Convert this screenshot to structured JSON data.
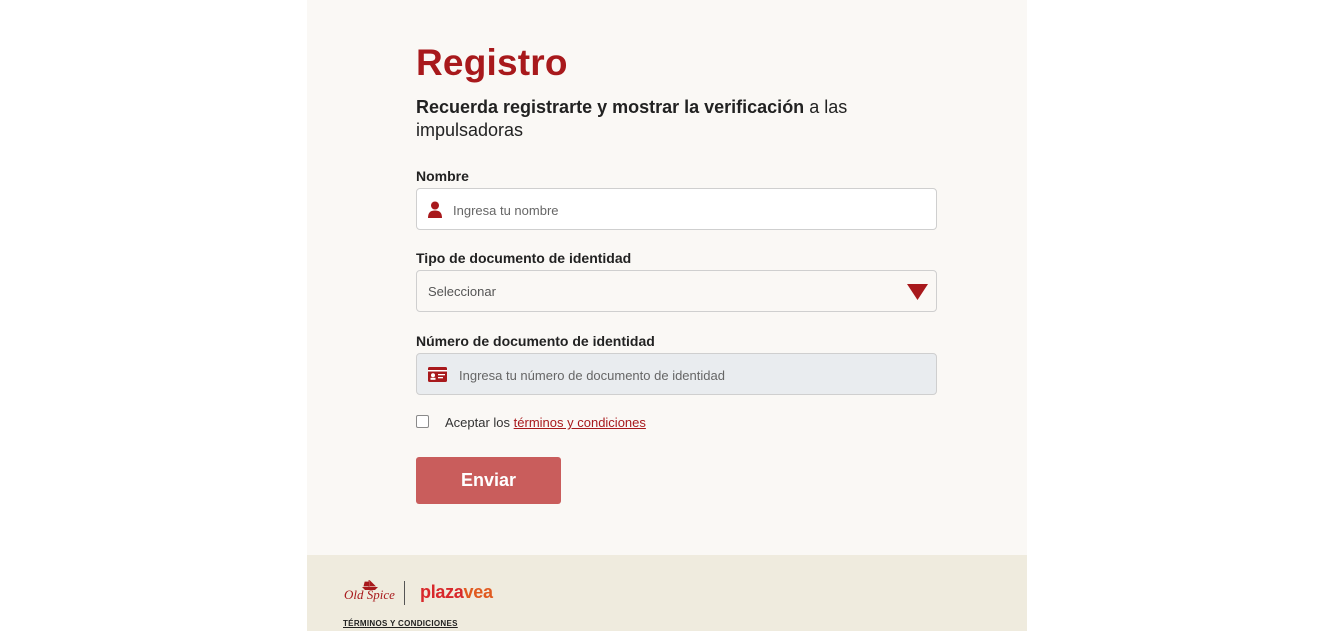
{
  "form": {
    "title": "Registro",
    "subtitle_bold": "Recuerda registrarte y mostrar la verificación",
    "subtitle_rest": " a las impulsadoras",
    "name_label": "Nombre",
    "name_placeholder": "Ingresa tu nombre",
    "doc_type_label": "Tipo de documento de identidad",
    "doc_type_value": "Seleccionar",
    "doc_number_label": "Número de documento de identidad",
    "doc_number_placeholder": "Ingresa tu número de documento de identidad",
    "accept_prefix": "Aceptar los ",
    "terms_link": "términos y condiciones",
    "submit_label": "Enviar"
  },
  "footer": {
    "brand1": "Old Spice",
    "brand2_a": "plaza",
    "brand2_b": "vea",
    "terms": "TÉRMINOS Y CONDICIONES"
  },
  "icons": {
    "name": "user-icon",
    "doc_type": "caret-down-icon",
    "doc_number": "id-card-icon"
  },
  "colors": {
    "accent": "#a8191c",
    "button": "#c95d5c",
    "page_bg": "#faf8f5",
    "footer_bg": "#efebde"
  }
}
